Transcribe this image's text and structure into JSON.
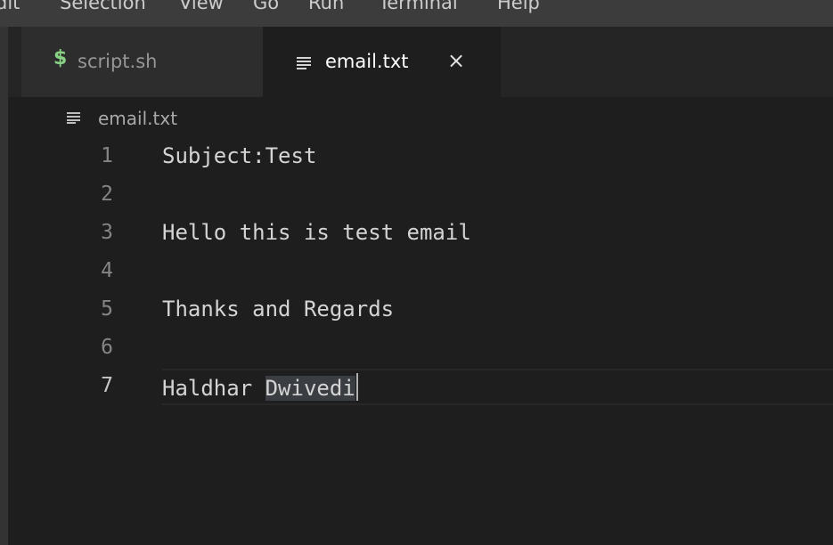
{
  "menubar": {
    "items": [
      "dit",
      "Selection",
      "View",
      "Go",
      "Run",
      "Terminal",
      "Help"
    ]
  },
  "tabs": [
    {
      "label": "script.sh",
      "icon": "dollar-icon",
      "active": false
    },
    {
      "label": "email.txt",
      "icon": "text-file-icon",
      "active": true,
      "close": "×"
    }
  ],
  "breadcrumb": {
    "file": "email.txt"
  },
  "editor": {
    "lines": [
      {
        "num": "1",
        "text": "Subject:Test"
      },
      {
        "num": "2",
        "text": ""
      },
      {
        "num": "3",
        "text": "Hello this is test email"
      },
      {
        "num": "4",
        "text": ""
      },
      {
        "num": "5",
        "text": "Thanks and Regards"
      },
      {
        "num": "6",
        "text": ""
      },
      {
        "num": "7",
        "text_plain": "Haldhar ",
        "text_selected": "Dwivedi"
      }
    ]
  },
  "colors": {
    "background": "#1e1e1e",
    "tabbar": "#252526",
    "inactive_tab": "#2d2d2d",
    "dollar_green": "#89d185",
    "line_number": "#858585",
    "text": "#d4d4d4",
    "selection_highlight": "#3a3d41"
  }
}
